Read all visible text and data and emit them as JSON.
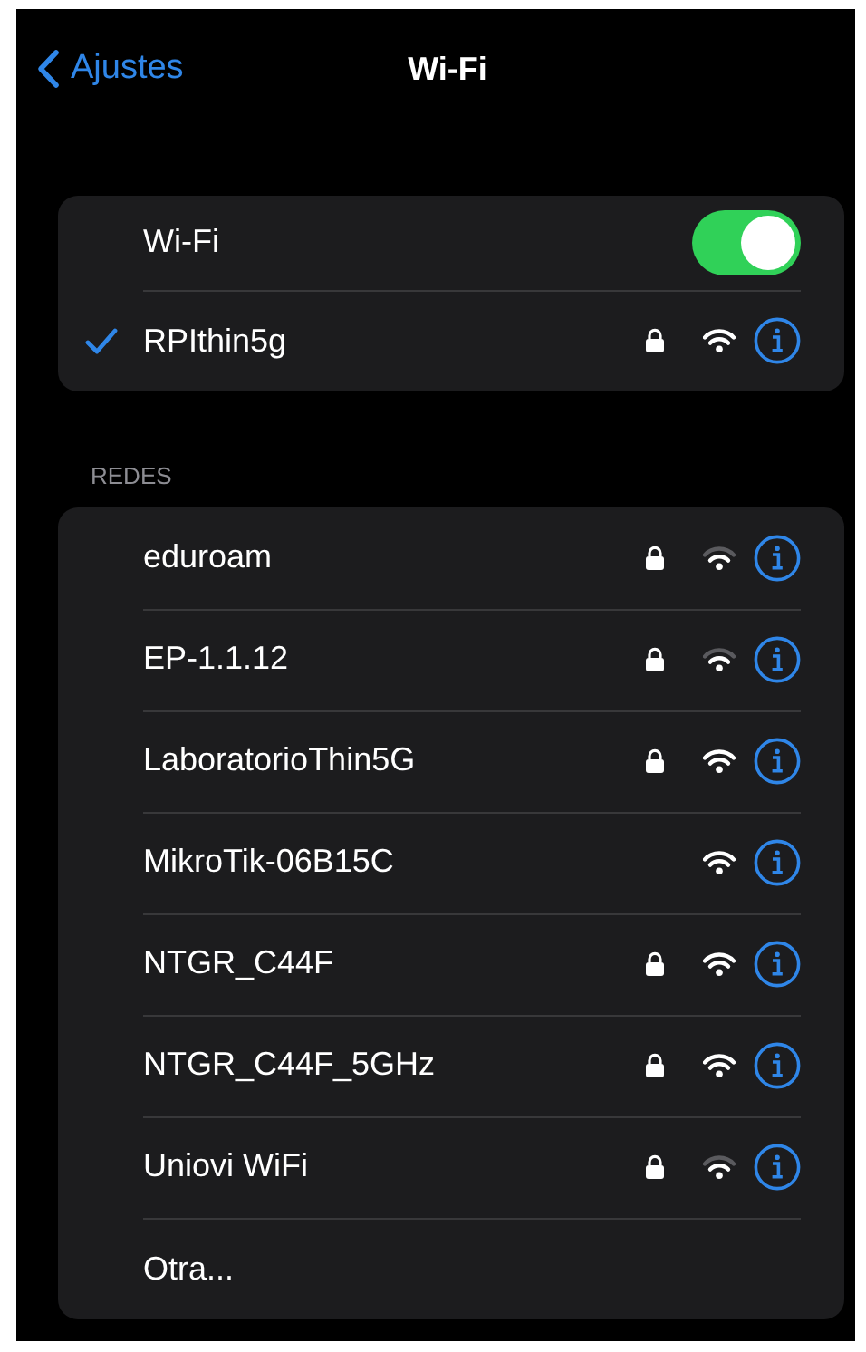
{
  "nav": {
    "back": "Ajustes",
    "title": "Wi-Fi"
  },
  "current": {
    "toggle_label": "Wi-Fi",
    "on": true,
    "network": {
      "name": "RPIthin5g",
      "selected": true,
      "locked": true,
      "weak_signal": false
    }
  },
  "section_header": "REDES",
  "networks": [
    {
      "name": "eduroam",
      "locked": true,
      "weak_signal": true
    },
    {
      "name": "EP-1.1.12",
      "locked": true,
      "weak_signal": true
    },
    {
      "name": "LaboratorioThin5G",
      "locked": true,
      "weak_signal": false
    },
    {
      "name": "MikroTik-06B15C",
      "locked": false,
      "weak_signal": false
    },
    {
      "name": "NTGR_C44F",
      "locked": true,
      "weak_signal": false
    },
    {
      "name": "NTGR_C44F_5GHz",
      "locked": true,
      "weak_signal": false
    },
    {
      "name": "Uniovi WiFi",
      "locked": true,
      "weak_signal": true
    }
  ],
  "other": "Otra..."
}
